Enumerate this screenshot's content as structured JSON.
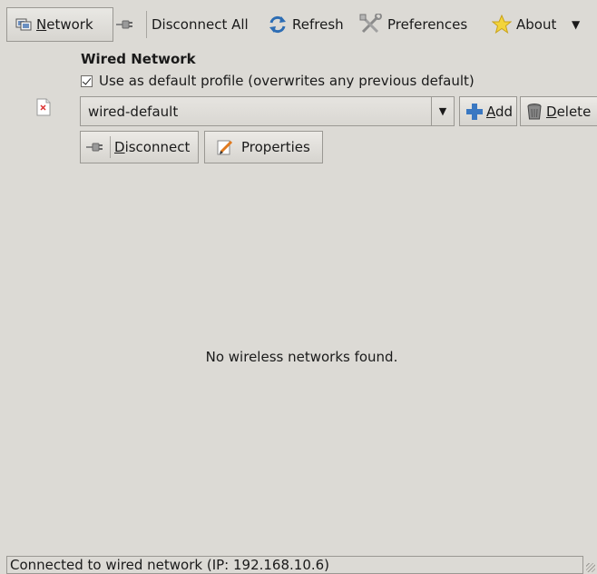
{
  "toolbar": {
    "network_label": "Network",
    "network_mnemonic": "N",
    "network_rest": "etwork",
    "disconnect_all_label": "Disconnect All",
    "refresh_label": "Refresh",
    "preferences_label": "Preferences",
    "about_label": "About",
    "overflow_label": "▼"
  },
  "wired": {
    "title": "Wired Network",
    "default_checkbox_label": "Use as default profile (overwrites any previous default)",
    "default_checked": true,
    "profile_value": "wired-default",
    "add_label": "Add",
    "add_mnemonic": "A",
    "add_rest": "dd",
    "delete_label": "Delete",
    "delete_mnemonic": "D",
    "delete_rest": "elete",
    "disconnect_label": "Disconnect",
    "disconnect_mnemonic": "D",
    "disconnect_rest": "isconnect",
    "properties_label": "Properties"
  },
  "wireless": {
    "empty_message": "No wireless networks found."
  },
  "status": {
    "text": "Connected to wired network (IP: 192.168.10.6)"
  },
  "icons": {
    "network": "network-icon",
    "disconnect": "plug-icon",
    "refresh": "refresh-icon",
    "preferences": "tools-icon",
    "about": "star-icon",
    "wired_status": "document-icon",
    "add": "plus-icon",
    "delete": "trash-icon",
    "properties": "edit-icon"
  },
  "colors": {
    "background": "#dcdad5",
    "plus_blue": "#3a78c2",
    "star_yellow": "#f3d43a",
    "refresh_blue": "#2d6db4"
  }
}
